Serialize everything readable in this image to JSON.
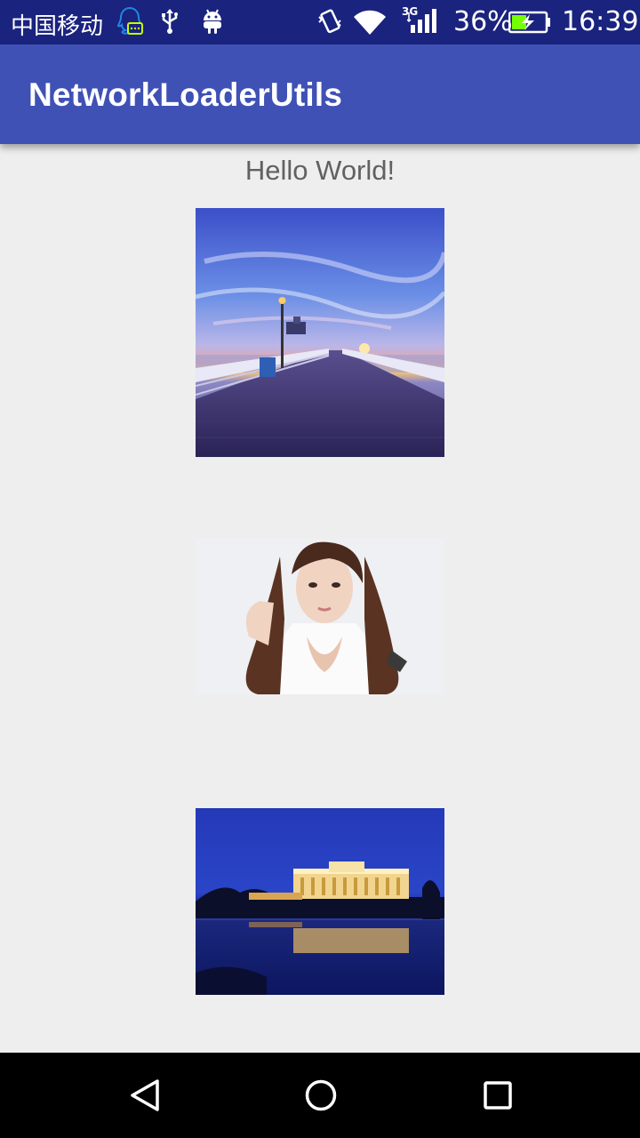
{
  "status_bar": {
    "carrier": "中国移动",
    "network_type": "3G",
    "battery_percent": "36%",
    "time": "16:39",
    "icons": [
      "qq-notification-icon",
      "usb-icon",
      "android-debug-icon",
      "vibrate-icon",
      "wifi-icon",
      "cell-signal-icon",
      "battery-charging-icon"
    ]
  },
  "app_bar": {
    "title": "NetworkLoaderUtils"
  },
  "main": {
    "hello_text": "Hello World!",
    "images": [
      {
        "name": "pier-sunset-image"
      },
      {
        "name": "portrait-image"
      },
      {
        "name": "night-building-reflection-image"
      }
    ]
  },
  "nav_bar": {
    "buttons": [
      "back",
      "home",
      "recents"
    ]
  },
  "colors": {
    "status_bar": "#1a237e",
    "app_bar": "#3f51b5",
    "background": "#eeeeee",
    "hello_text": "#616161"
  }
}
